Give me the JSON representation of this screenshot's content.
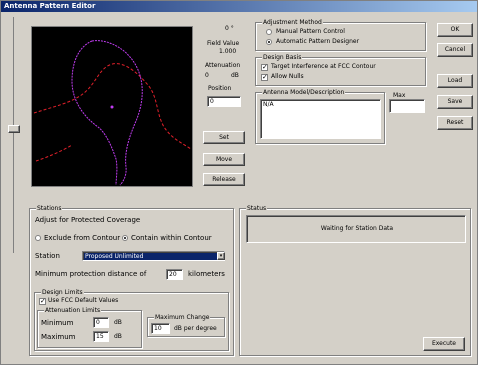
{
  "window": {
    "title": "Antenna Pattern Editor"
  },
  "pattern_readout": {
    "angle_value": "0 °",
    "field_value_label": "Field Value",
    "field_value": "1.000",
    "attenuation_label": "Attenuation",
    "attenuation_value": "0",
    "attenuation_unit": "dB",
    "position_label": "Position",
    "position_value": "0"
  },
  "plot_buttons": {
    "set": "Set",
    "move": "Move",
    "release": "Release"
  },
  "adjustment_method": {
    "legend": "Adjustment Method",
    "options": [
      "Manual Pattern Control",
      "Automatic Pattern Designer"
    ],
    "selected_index": 1
  },
  "design_basis": {
    "legend": "Design Basis",
    "options": [
      "Target Interference at FCC Contour",
      "Allow Nulls"
    ],
    "checked": [
      true,
      true
    ]
  },
  "antenna_model": {
    "legend": "Antenna Model/Description",
    "value": "N/A",
    "max_label": "Max",
    "max_value": ""
  },
  "side_buttons": {
    "ok": "OK",
    "cancel": "Cancel",
    "load": "Load",
    "save": "Save",
    "reset": "Reset"
  },
  "station": {
    "legend": "Stations",
    "adjust_label": "Adjust for Protected Coverage",
    "contour_options": [
      "Exclude from Contour",
      "Contain within Contour"
    ],
    "contour_selected": 1,
    "stations_label": "Station",
    "station_select": "Proposed Unlimited",
    "min_separation_label": "Minimum protection distance of",
    "min_separation_value": "20",
    "min_separation_unit": "kilometers"
  },
  "design_limits": {
    "legend": "Design Limits",
    "use_fcc_label": "Use FCC Default Values",
    "use_fcc_checked": true,
    "atten_legend": "Attenuation Limits",
    "minimum_label": "Minimum",
    "minimum_value": "0",
    "maximum_label": "Maximum",
    "maximum_value": "15",
    "unit": "dB",
    "max_change_legend": "Maximum Change",
    "max_change_value": "10",
    "max_change_unit": "dB per degree"
  },
  "status": {
    "legend": "Status",
    "message": "Waiting for Station Data"
  },
  "execute_button": "Execute",
  "colors": {
    "title_start": "#0a246a",
    "title_end": "#a6caf0",
    "face": "#d4d0c8",
    "plot_bg": "#000000",
    "contour_red": "#e0202a",
    "pattern_magenta": "#c03cf0"
  }
}
